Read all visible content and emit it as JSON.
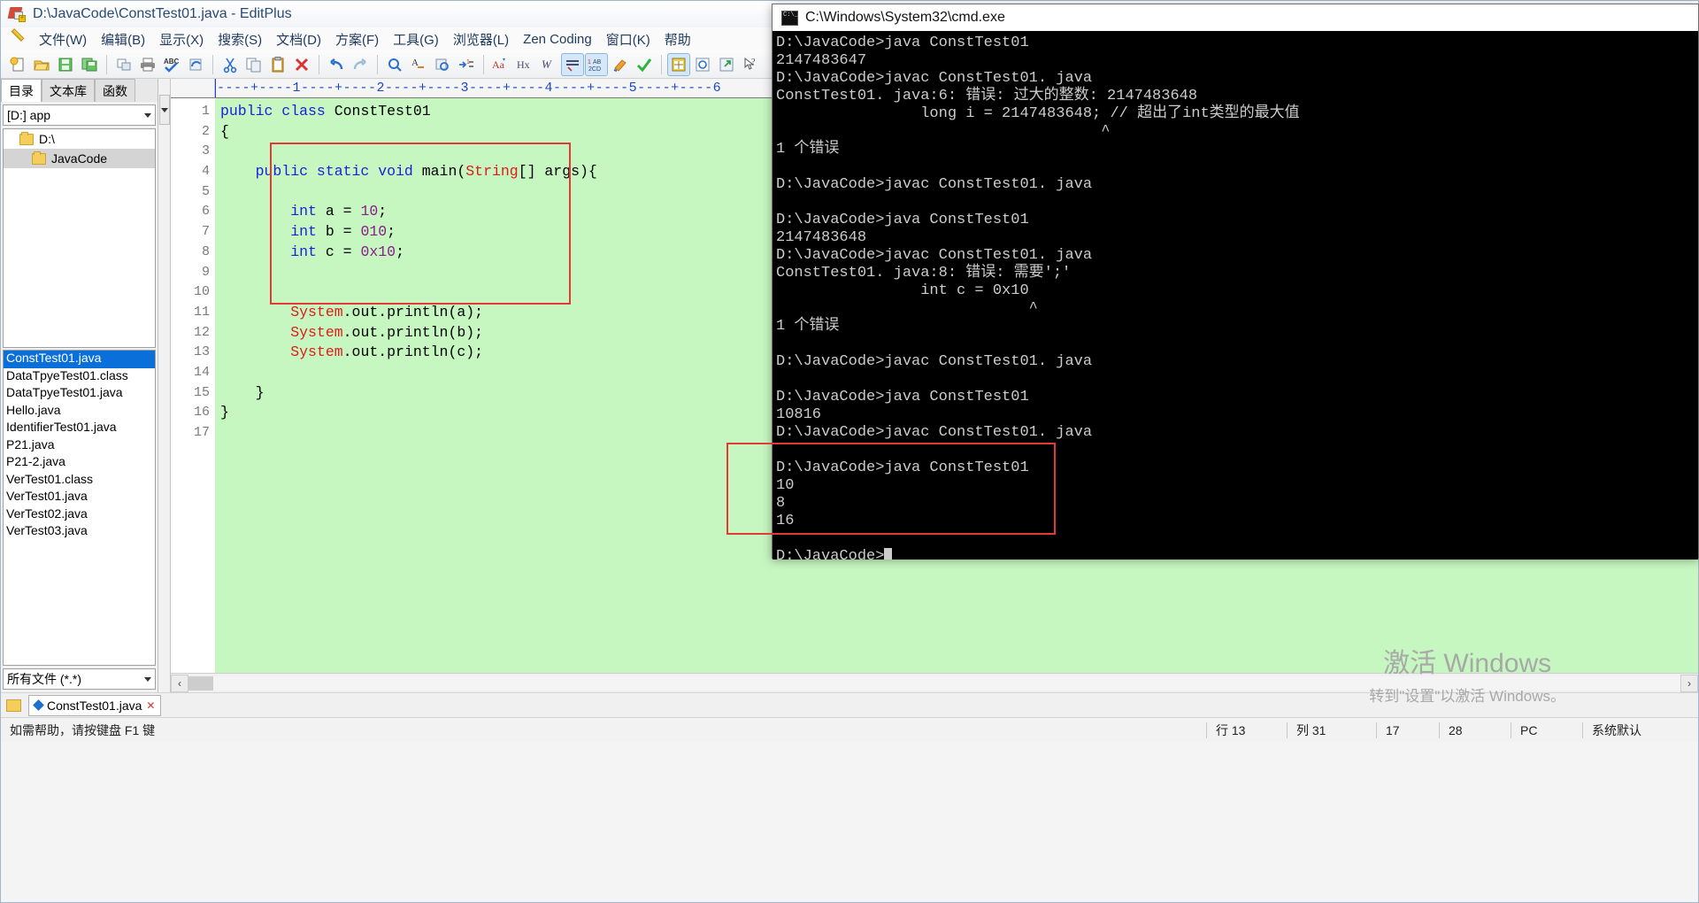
{
  "editplus": {
    "title": "D:\\JavaCode\\ConstTest01.java - EditPlus",
    "menus": [
      "文件(W)",
      "编辑(B)",
      "显示(X)",
      "搜索(S)",
      "文档(D)",
      "方案(F)",
      "工具(G)",
      "浏览器(L)",
      "Zen Coding",
      "窗口(K)",
      "帮助"
    ],
    "toolbar_icons": [
      "new-file-icon",
      "open-file-icon",
      "save-icon",
      "save-all-icon",
      "page-setup-icon",
      "print-icon",
      "spellcheck-icon",
      "reload-icon",
      "cut-icon",
      "copy-icon",
      "paste-icon",
      "delete-icon",
      "undo-icon",
      "redo-icon",
      "find-icon",
      "replace-icon",
      "find-in-files-icon",
      "goto-line-icon",
      "toggle-case-icon",
      "hex-view-icon",
      "word-wrap-icon",
      "show-whitespace-icon",
      "line-numbers-icon",
      "highlight-icon",
      "html-preview-icon",
      "browser-preview-icon",
      "external-browser-icon",
      "whats-this-icon"
    ],
    "panel": {
      "tabs": [
        "目录",
        "文本库",
        "函数"
      ],
      "selected_tab": "目录",
      "drive": "[D:] app",
      "tree": [
        {
          "label": "D:\\",
          "level": 1,
          "selected": false
        },
        {
          "label": "JavaCode",
          "level": 2,
          "selected": true
        }
      ],
      "files": [
        {
          "name": "ConstTest01.java",
          "selected": true
        },
        {
          "name": "DataTpyeTest01.class",
          "selected": false
        },
        {
          "name": "DataTpyeTest01.java",
          "selected": false
        },
        {
          "name": "Hello.java",
          "selected": false
        },
        {
          "name": "IdentifierTest01.java",
          "selected": false
        },
        {
          "name": "P21.java",
          "selected": false
        },
        {
          "name": "P21-2.java",
          "selected": false
        },
        {
          "name": "VerTest01.class",
          "selected": false
        },
        {
          "name": "VerTest01.java",
          "selected": false
        },
        {
          "name": "VerTest02.java",
          "selected": false
        },
        {
          "name": "VerTest03.java",
          "selected": false
        }
      ],
      "filter": "所有文件 (*.*)"
    },
    "editor": {
      "ruler": "----+----1----+----2----+----3----+----4----+----5----+----6",
      "lines": [
        {
          "no": "1",
          "fold": "",
          "tokens": [
            {
              "t": "public class ",
              "c": "kw"
            },
            {
              "t": "ConstTest01",
              "c": "cm"
            }
          ]
        },
        {
          "no": "2",
          "fold": "-",
          "tokens": [
            {
              "t": "{",
              "c": "cm"
            }
          ]
        },
        {
          "no": "3",
          "fold": "",
          "tokens": []
        },
        {
          "no": "4",
          "fold": "-",
          "tokens": [
            {
              "t": "    public static void ",
              "c": "kw"
            },
            {
              "t": "main(",
              "c": "cm"
            },
            {
              "t": "String",
              "c": "cls"
            },
            {
              "t": "[] args){",
              "c": "cm"
            }
          ]
        },
        {
          "no": "5",
          "fold": "",
          "tokens": []
        },
        {
          "no": "6",
          "fold": "",
          "tokens": [
            {
              "t": "        ",
              "c": "cm"
            },
            {
              "t": "int",
              "c": "kw"
            },
            {
              "t": " a = ",
              "c": "cm"
            },
            {
              "t": "10",
              "c": "num"
            },
            {
              "t": ";",
              "c": "cm"
            }
          ]
        },
        {
          "no": "7",
          "fold": "",
          "tokens": [
            {
              "t": "        ",
              "c": "cm"
            },
            {
              "t": "int",
              "c": "kw"
            },
            {
              "t": " b = ",
              "c": "cm"
            },
            {
              "t": "010",
              "c": "num"
            },
            {
              "t": ";",
              "c": "cm"
            }
          ]
        },
        {
          "no": "8",
          "fold": "",
          "tokens": [
            {
              "t": "        ",
              "c": "cm"
            },
            {
              "t": "int",
              "c": "kw"
            },
            {
              "t": " c = ",
              "c": "cm"
            },
            {
              "t": "0x10",
              "c": "num"
            },
            {
              "t": ";",
              "c": "cm"
            }
          ]
        },
        {
          "no": "9",
          "fold": "",
          "tokens": []
        },
        {
          "no": "10",
          "fold": "",
          "tokens": []
        },
        {
          "no": "11",
          "fold": "",
          "tokens": [
            {
              "t": "        ",
              "c": "cm"
            },
            {
              "t": "System",
              "c": "cls"
            },
            {
              "t": ".out.println(a);",
              "c": "cm"
            }
          ]
        },
        {
          "no": "12",
          "fold": "",
          "tokens": [
            {
              "t": "        ",
              "c": "cm"
            },
            {
              "t": "System",
              "c": "cls"
            },
            {
              "t": ".out.println(b);",
              "c": "cm"
            }
          ]
        },
        {
          "no": "13",
          "fold": "",
          "tokens": [
            {
              "t": "        ",
              "c": "cm"
            },
            {
              "t": "System",
              "c": "cls"
            },
            {
              "t": ".out.println(c);",
              "c": "cm"
            }
          ]
        },
        {
          "no": "14",
          "fold": "",
          "tokens": []
        },
        {
          "no": "15",
          "fold": "",
          "tokens": [
            {
              "t": "    }",
              "c": "cm"
            }
          ]
        },
        {
          "no": "16",
          "fold": "",
          "tokens": [
            {
              "t": "}",
              "c": "cm"
            }
          ]
        },
        {
          "no": "17",
          "fold": "",
          "tokens": []
        }
      ],
      "highlight_color": "#e53935"
    },
    "doc_tab": "ConstTest01.java",
    "status": {
      "hint": "如需帮助，请按键盘 F1 键",
      "row": "行 13",
      "col": "列 31",
      "c1": "17",
      "c2": "28",
      "mode": "PC",
      "encoding": "系统默认"
    },
    "watermark": {
      "line1": "激活 Windows",
      "line2": "转到\"设置\"以激活 Windows。"
    }
  },
  "cmd": {
    "title": "C:\\Windows\\System32\\cmd.exe",
    "lines": [
      "D:\\JavaCode>java ConstTest01",
      "2147483647",
      "D:\\JavaCode>javac ConstTest01. java",
      "ConstTest01. java:6: 错误: 过大的整数: 2147483648",
      "                long i = 2147483648; // 超出了int类型的最大值",
      "                                    ^",
      "1 个错误",
      "",
      "D:\\JavaCode>javac ConstTest01. java",
      "",
      "D:\\JavaCode>java ConstTest01",
      "2147483648",
      "D:\\JavaCode>javac ConstTest01. java",
      "ConstTest01. java:8: 错误: 需要';'",
      "                int c = 0x10",
      "                            ^",
      "1 个错误",
      "",
      "D:\\JavaCode>javac ConstTest01. java",
      "",
      "D:\\JavaCode>java ConstTest01",
      "10816",
      "D:\\JavaCode>javac ConstTest01. java",
      "",
      "D:\\JavaCode>java ConstTest01",
      "10",
      "8",
      "16",
      ""
    ],
    "prompt": "D:\\JavaCode>",
    "highlight_color": "#e53935"
  }
}
